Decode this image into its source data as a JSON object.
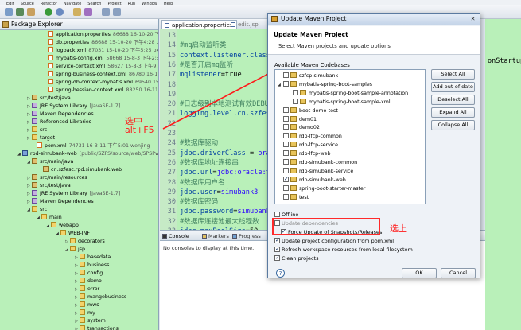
{
  "menubar": {
    "items": [
      "Edit",
      "Source",
      "Refactor",
      "Navigate",
      "Search",
      "Project",
      "Run",
      "Window",
      "Help"
    ]
  },
  "package_explorer": {
    "title": "Package Explorer",
    "rows": [
      {
        "label": "application.properties",
        "meta": "86688  16-10-20 下午",
        "icon": "xml",
        "indent": 54
      },
      {
        "label": "db.properties",
        "meta": "86688  15-10-20 下午4:28  pkt",
        "icon": "xml",
        "indent": 54
      },
      {
        "label": "logback.xml",
        "meta": "87031  15-10-20 下午5:25  pxl",
        "icon": "xml",
        "indent": 54
      },
      {
        "label": "mybatis-config.xml",
        "meta": "58668  15-8-3 下午2:52  c",
        "icon": "xml",
        "indent": 54
      },
      {
        "label": "service-context.xml",
        "meta": "58627  15-8-3 上午9:23  pxr",
        "icon": "xml",
        "indent": 54
      },
      {
        "label": "spring-business-context.xml",
        "meta": "86780  16-11-23",
        "icon": "xml",
        "indent": 54
      },
      {
        "label": "spring-db-context-mybatis.xml",
        "meta": "69540  15-11",
        "icon": "xml",
        "indent": 54
      },
      {
        "label": "spring-hessian-context.xml",
        "meta": "88250  16-11-7",
        "icon": "xml",
        "indent": 54
      },
      {
        "label": "src/test/java",
        "meta": "",
        "icon": "pkg",
        "indent": 34,
        "tri": "▷"
      },
      {
        "label": "JRE System Library",
        "meta": "[JavaSE-1.7]",
        "icon": "lib",
        "indent": 34,
        "tri": "▷"
      },
      {
        "label": "Maven Dependencies",
        "meta": "",
        "icon": "lib",
        "indent": 34,
        "tri": "▷"
      },
      {
        "label": "Referenced Libraries",
        "meta": "",
        "icon": "lib",
        "indent": 34,
        "tri": "▷"
      },
      {
        "label": "src",
        "meta": "",
        "icon": "fold",
        "indent": 34,
        "tri": "▷"
      },
      {
        "label": "target",
        "meta": "",
        "icon": "fold",
        "indent": 34,
        "tri": "▷"
      },
      {
        "label": "pom.xml",
        "meta": "74731  16-3-11 下午5:01  wenjing",
        "icon": "xml",
        "indent": 40
      },
      {
        "label": "rpd-simubank-web",
        "meta": "[public/SZFS/source/web/SPSPwe",
        "icon": "proj",
        "indent": 22,
        "tri": "◢"
      },
      {
        "label": "src/main/java",
        "meta": "",
        "icon": "pkg",
        "indent": 34,
        "tri": "◢"
      },
      {
        "label": "cn.szfesc.rpd.simubank.web",
        "meta": "",
        "icon": "pkg",
        "indent": 48
      },
      {
        "label": "src/main/resources",
        "meta": "",
        "icon": "pkg",
        "indent": 34,
        "tri": "▷"
      },
      {
        "label": "src/test/java",
        "meta": "",
        "icon": "pkg",
        "indent": 34,
        "tri": "▷"
      },
      {
        "label": "JRE System Library",
        "meta": "[JavaSE-1.7]",
        "icon": "lib",
        "indent": 34,
        "tri": "▷"
      },
      {
        "label": "Maven Dependencies",
        "meta": "",
        "icon": "lib",
        "indent": 34,
        "tri": "▷"
      },
      {
        "label": "src",
        "meta": "",
        "icon": "fold",
        "indent": 34,
        "tri": "◢"
      },
      {
        "label": "main",
        "meta": "",
        "icon": "fold",
        "indent": 46,
        "tri": "◢"
      },
      {
        "label": "webapp",
        "meta": "",
        "icon": "fold",
        "indent": 58,
        "tri": "◢"
      },
      {
        "label": "WEB-INF",
        "meta": "",
        "icon": "fold",
        "indent": 70,
        "tri": "◢"
      },
      {
        "label": "decorators",
        "meta": "",
        "icon": "fold",
        "indent": 82,
        "tri": "▷"
      },
      {
        "label": "jsp",
        "meta": "",
        "icon": "fold",
        "indent": 82,
        "tri": "◢"
      },
      {
        "label": "basedata",
        "meta": "",
        "icon": "fold",
        "indent": 94,
        "tri": "▷"
      },
      {
        "label": "business",
        "meta": "",
        "icon": "fold",
        "indent": 94,
        "tri": "▷"
      },
      {
        "label": "config",
        "meta": "",
        "icon": "fold",
        "indent": 94,
        "tri": "▷"
      },
      {
        "label": "demo",
        "meta": "",
        "icon": "fold",
        "indent": 94,
        "tri": "▷"
      },
      {
        "label": "error",
        "meta": "",
        "icon": "fold",
        "indent": 94,
        "tri": "▷"
      },
      {
        "label": "mangebusiness",
        "meta": "",
        "icon": "fold",
        "indent": 94,
        "tri": "▷"
      },
      {
        "label": "mws",
        "meta": "",
        "icon": "fold",
        "indent": 94,
        "tri": "▷"
      },
      {
        "label": "my",
        "meta": "",
        "icon": "fold",
        "indent": 94,
        "tri": "▷"
      },
      {
        "label": "system",
        "meta": "",
        "icon": "fold",
        "indent": 94,
        "tri": "▷"
      },
      {
        "label": "transactions",
        "meta": "",
        "icon": "fold",
        "indent": 94,
        "tri": "▷"
      }
    ]
  },
  "editor": {
    "tabs": [
      {
        "label": "application.properties",
        "active": true
      },
      {
        "label": "edit.jsp",
        "active": false
      }
    ],
    "lines": [
      {
        "n": "13",
        "parts": [
          {
            "t": "",
            "c": ""
          }
        ]
      },
      {
        "n": "14",
        "parts": [
          {
            "t": "#mq启动监听类",
            "c": "comment"
          }
        ]
      },
      {
        "n": "15",
        "parts": [
          {
            "t": "context.listener.classes",
            "c": "key"
          }
        ]
      },
      {
        "n": "16",
        "parts": [
          {
            "t": "#是否开启mq监听",
            "c": "comment"
          }
        ]
      },
      {
        "n": "17",
        "parts": [
          {
            "t": "mqlistener",
            "c": "key"
          },
          {
            "t": "=true",
            "c": ""
          }
        ]
      },
      {
        "n": "18",
        "parts": [
          {
            "t": "",
            "c": ""
          }
        ]
      },
      {
        "n": "19",
        "parts": [
          {
            "t": "",
            "c": ""
          }
        ]
      },
      {
        "n": "20",
        "parts": [
          {
            "t": "#日志级别本地测试有效DEBUG",
            "c": "comment"
          }
        ]
      },
      {
        "n": "21",
        "parts": [
          {
            "t": "logging.level.cn.szfesc",
            "c": "key"
          }
        ]
      },
      {
        "n": "22",
        "parts": [
          {
            "t": "",
            "c": ""
          }
        ]
      },
      {
        "n": "23",
        "parts": [
          {
            "t": "",
            "c": ""
          }
        ]
      },
      {
        "n": "24",
        "parts": [
          {
            "t": "#数据库驱动",
            "c": "comment"
          }
        ]
      },
      {
        "n": "25",
        "parts": [
          {
            "t": "jdbc.driverClass",
            "c": "key"
          },
          {
            "t": " = ",
            "c": ""
          },
          {
            "t": "orac",
            "c": "val"
          }
        ]
      },
      {
        "n": "26",
        "parts": [
          {
            "t": "#数据库地址连接串",
            "c": "comment"
          }
        ]
      },
      {
        "n": "27",
        "parts": [
          {
            "t": "jdbc.url",
            "c": "key"
          },
          {
            "t": "=",
            "c": ""
          },
          {
            "t": "jdbc:oracle:th",
            "c": "val"
          }
        ]
      },
      {
        "n": "28",
        "parts": [
          {
            "t": "#数据库用户名",
            "c": "comment"
          }
        ]
      },
      {
        "n": "29",
        "parts": [
          {
            "t": "jdbc.user",
            "c": "key"
          },
          {
            "t": "=",
            "c": ""
          },
          {
            "t": "simubank3",
            "c": "val"
          }
        ]
      },
      {
        "n": "30",
        "parts": [
          {
            "t": "#数据库密码",
            "c": "comment"
          }
        ]
      },
      {
        "n": "31",
        "parts": [
          {
            "t": "jdbc.password",
            "c": "key"
          },
          {
            "t": "=",
            "c": ""
          },
          {
            "t": "simubank",
            "c": "val"
          }
        ]
      },
      {
        "n": "32",
        "parts": [
          {
            "t": "#数据库连接池最大线程数",
            "c": "comment"
          }
        ]
      },
      {
        "n": "33",
        "parts": [
          {
            "t": "jdbc.maxPoolSize",
            "c": "key"
          },
          {
            "t": "=50",
            "c": ""
          }
        ]
      }
    ]
  },
  "right_text": "onStartup",
  "console": {
    "tabs": [
      "Console",
      "Markers",
      "Progress"
    ],
    "message": "No consoles to display at this time."
  },
  "annotations": {
    "left": "选中\nalt+F5",
    "right": "选上"
  },
  "dialog": {
    "title": "Update Maven Project",
    "header_title": "Update Maven Project",
    "header_sub": "Select Maven projects and update options",
    "codebases_label": "Available Maven Codebases",
    "codebases": [
      {
        "label": "szfcp-simubank",
        "checked": false,
        "indent": 0,
        "tri": ""
      },
      {
        "label": "mybatis-spring-boot-samples",
        "checked": false,
        "indent": 0,
        "tri": "◢"
      },
      {
        "label": "mybatis-spring-boot-sample-annotation",
        "checked": false,
        "indent": 12,
        "tri": ""
      },
      {
        "label": "mybatis-spring-boot-sample-xml",
        "checked": false,
        "indent": 12,
        "tri": ""
      },
      {
        "label": "boot-demo-test",
        "checked": false,
        "indent": 0,
        "tri": ""
      },
      {
        "label": "dem01",
        "checked": false,
        "indent": 0,
        "tri": ""
      },
      {
        "label": "demo02",
        "checked": false,
        "indent": 0,
        "tri": ""
      },
      {
        "label": "rdp-lfcp-common",
        "checked": false,
        "indent": 0,
        "tri": ""
      },
      {
        "label": "rdp-lfcp-service",
        "checked": false,
        "indent": 0,
        "tri": ""
      },
      {
        "label": "rdp-lfcp-web",
        "checked": false,
        "indent": 0,
        "tri": ""
      },
      {
        "label": "rdp-simubank-common",
        "checked": false,
        "indent": 0,
        "tri": ""
      },
      {
        "label": "rdp-simubank-service",
        "checked": false,
        "indent": 0,
        "tri": ""
      },
      {
        "label": "rdp-simubank-web",
        "checked": true,
        "indent": 0,
        "tri": ""
      },
      {
        "label": "spring-boot-starter-master",
        "checked": false,
        "indent": 0,
        "tri": ""
      },
      {
        "label": "test",
        "checked": false,
        "indent": 0,
        "tri": ""
      }
    ],
    "buttons": {
      "select_all": "Select All",
      "add_out_of_date": "Add out-of-date",
      "deselect_all": "Deselect All",
      "expand_all": "Expand All",
      "collapse_all": "Collapse All"
    },
    "options": {
      "offline": "Offline",
      "update_deps": "Update dependencies",
      "force_update": "Force Update of Snapshots/Releases",
      "update_config": "Update project configuration from pom.xml",
      "refresh": "Refresh workspace resources from local filesystem",
      "clean": "Clean projects"
    },
    "ok": "OK",
    "cancel": "Cancel",
    "help": "?"
  },
  "colors": {
    "annotation": "#ff1a1a",
    "editor_bg": "#b9f0b9"
  }
}
